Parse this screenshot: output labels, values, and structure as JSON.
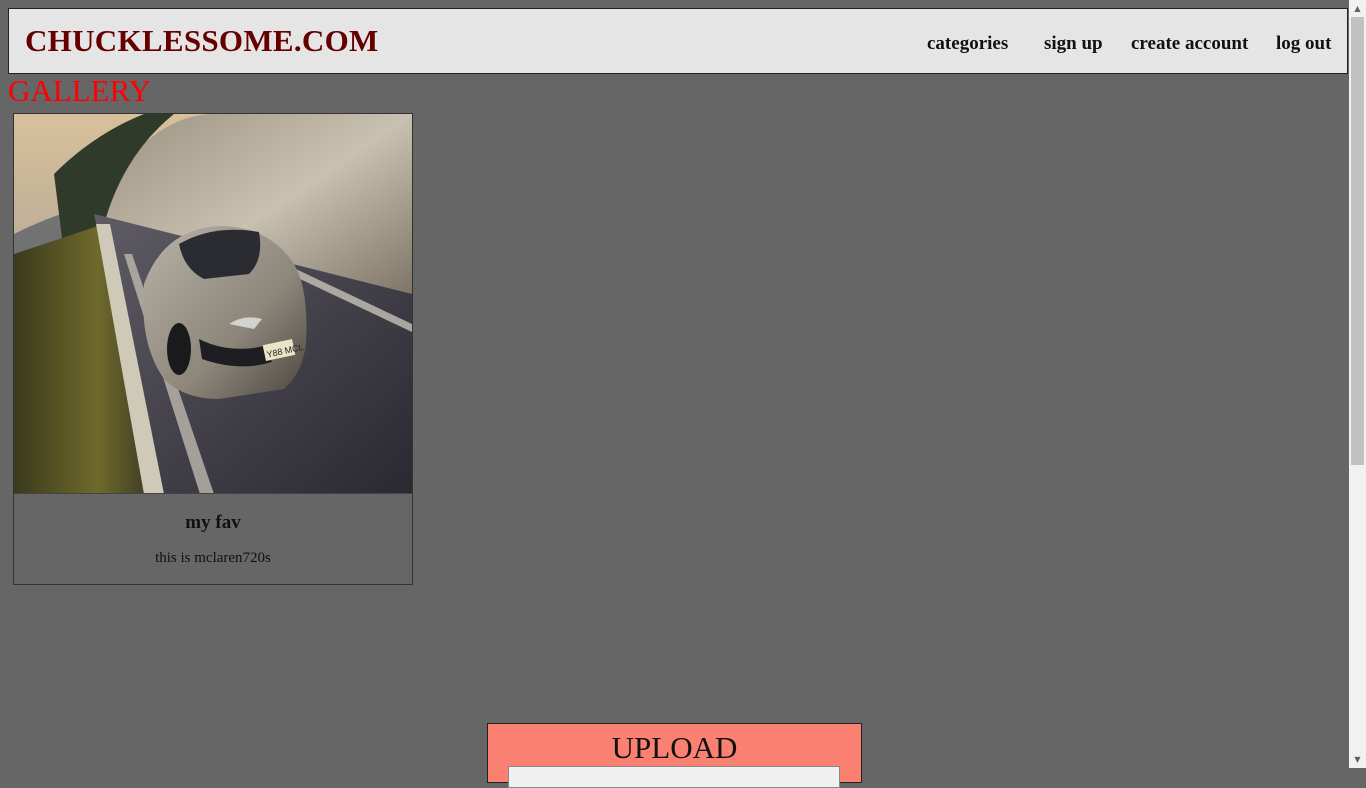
{
  "header": {
    "logo": "CHUCKLESSOME.COM",
    "nav": [
      {
        "label": "categories"
      },
      {
        "label": "sign up"
      },
      {
        "label": "create account"
      },
      {
        "label": "log out"
      }
    ]
  },
  "gallery": {
    "title": "GALLERY",
    "items": [
      {
        "title": "my fav",
        "description": "this is mclaren720s",
        "plate": "Y88 MCL"
      }
    ]
  },
  "upload": {
    "label": "UPLOAD"
  },
  "colors": {
    "page_background": "#666666",
    "header_background": "#e5e5e5",
    "logo": "#660000",
    "gallery_title": "#ff0000",
    "upload_background": "#fa8072"
  },
  "icons": {
    "scroll_up": "triangle-up-icon",
    "scroll_down": "triangle-down-icon"
  }
}
